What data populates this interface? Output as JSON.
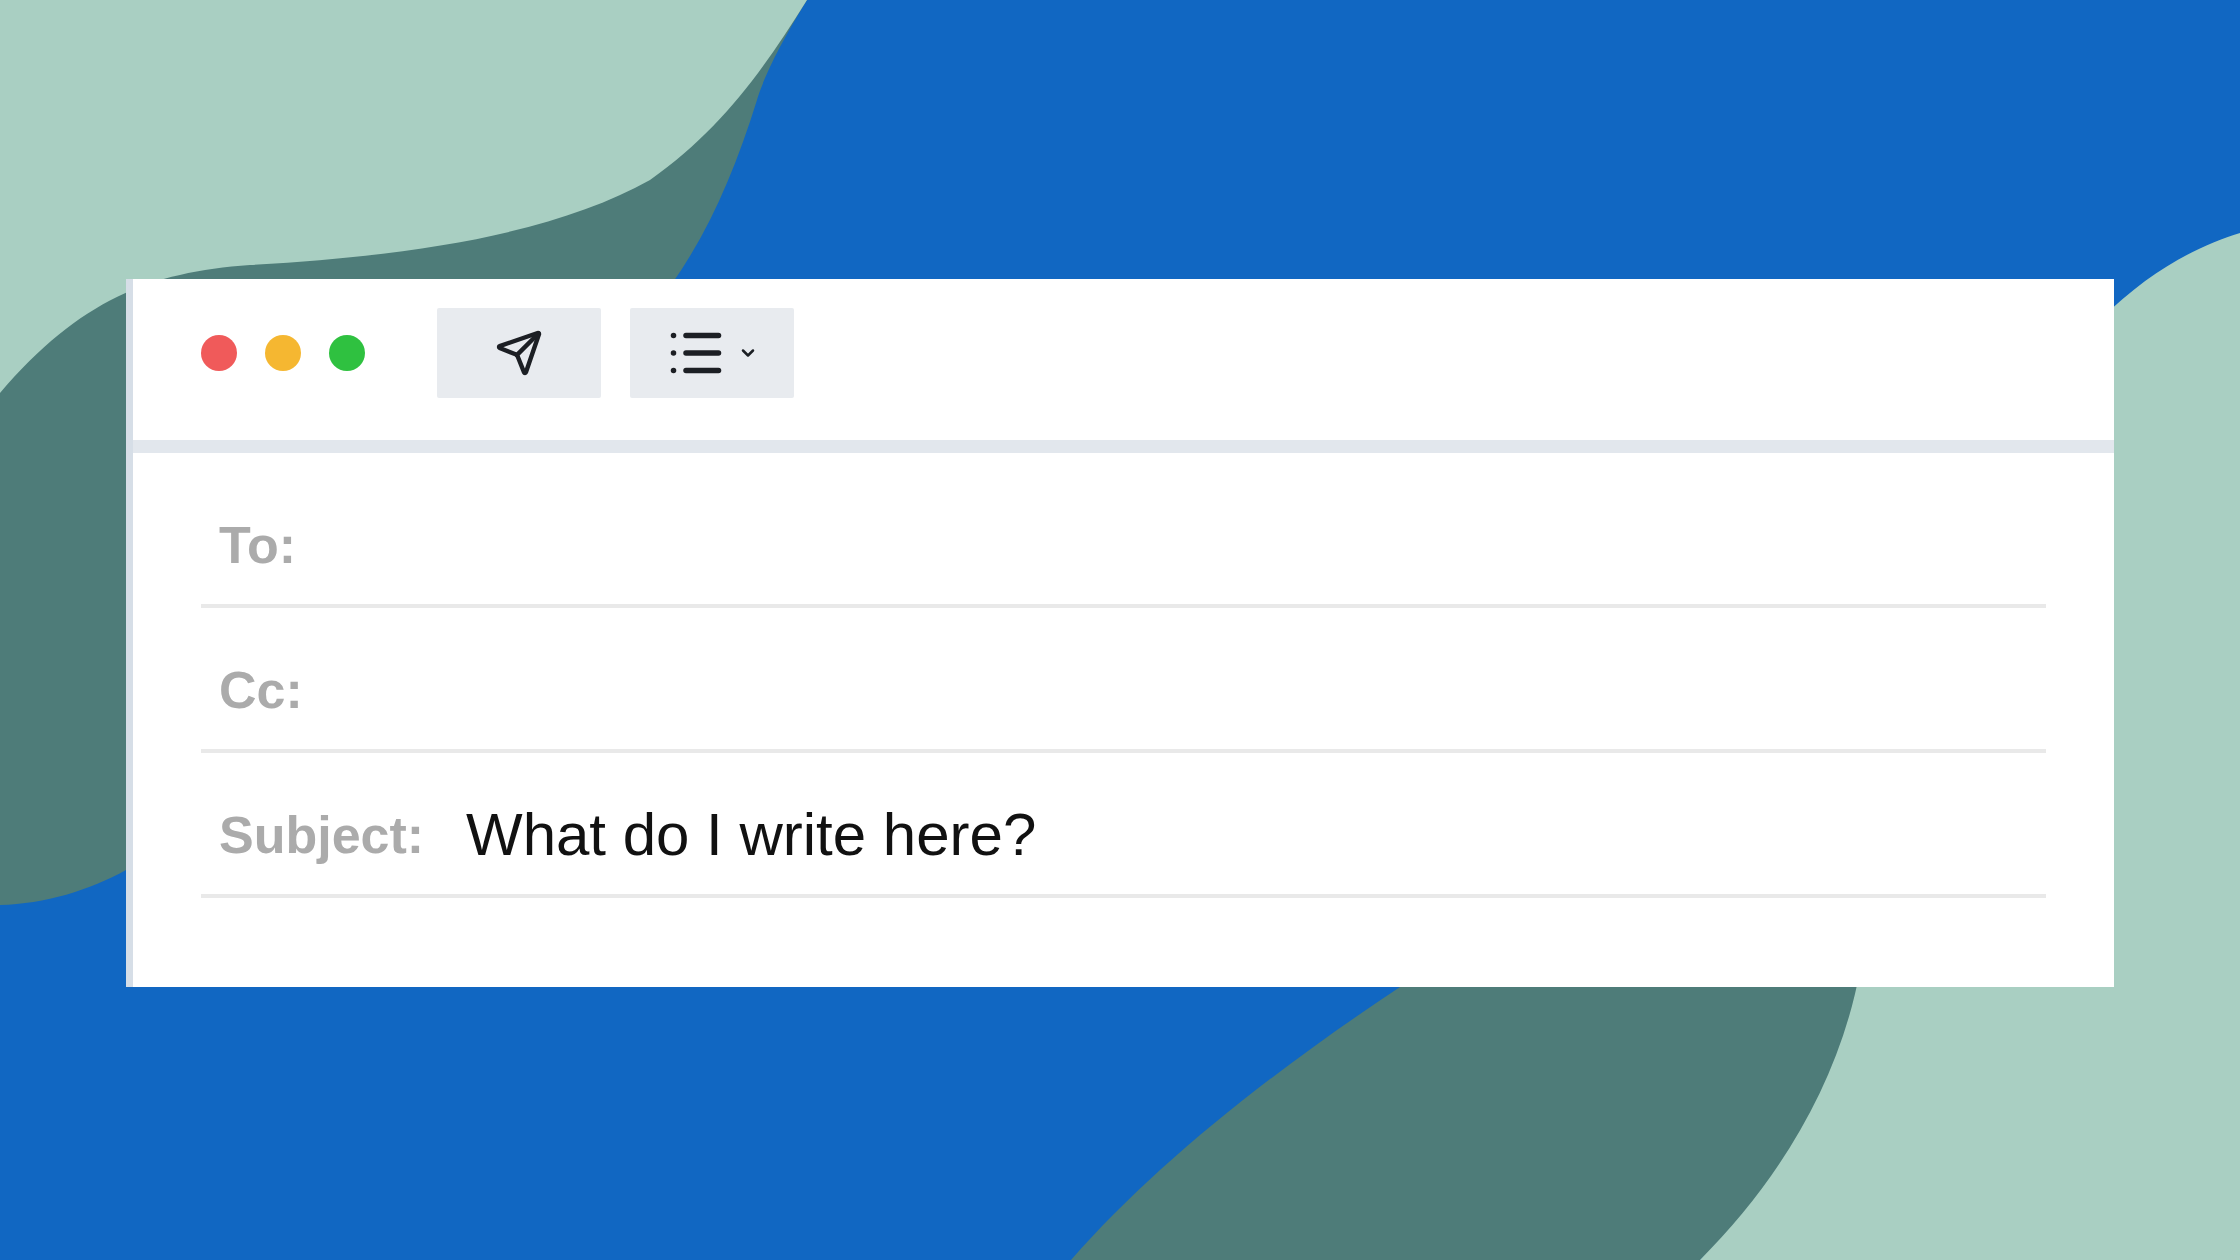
{
  "window": {
    "controls": [
      {
        "color": "#f05a5a"
      },
      {
        "color": "#f5b731"
      },
      {
        "color": "#2fc140"
      }
    ]
  },
  "toolbar": {
    "buttons": [
      {
        "kind": "send"
      },
      {
        "kind": "list-menu"
      }
    ]
  },
  "fields": [
    {
      "label": "To:"
    },
    {
      "label": "Cc:"
    },
    {
      "label": "Subject:",
      "value": "What do I write here?"
    }
  ]
}
